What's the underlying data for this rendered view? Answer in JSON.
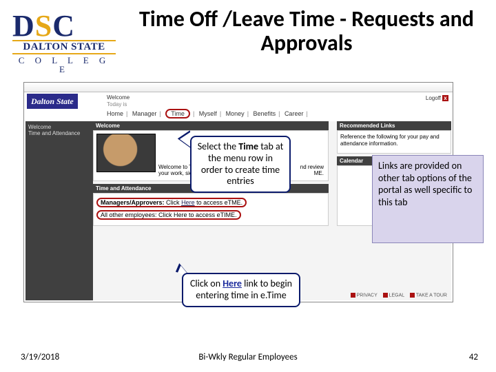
{
  "title": "Time Off /Leave Time - Requests and Approvals",
  "logo": {
    "initials_d": "D",
    "initials_s": "S",
    "initials_c": "C",
    "line1": "DALTON STATE",
    "line2": "C O L L E G E"
  },
  "callouts": {
    "time_tab_pre": "Select the ",
    "time_tab_bold": "Time",
    "time_tab_post": " tab at the menu row in order to create time entries",
    "here_pre": "Click on ",
    "here_link": "Here",
    "here_post": " link to begin entering time in e.Time"
  },
  "note": "Links are provided on other tab options of the portal as well specific to this tab",
  "screenshot": {
    "brand": "Dalton State",
    "logout": "Logoff",
    "welcome_user": "Welcome",
    "today": "Today is",
    "menu": [
      "Home",
      "Manager",
      "Time",
      "Myself",
      "Money",
      "Benefits",
      "Career"
    ],
    "sidebar": {
      "line1": "Welcome",
      "line2": "Time and Attendance"
    },
    "panel_welcome_h": "Welcome",
    "panel_welcome_text1": "Welcome to Time and Att",
    "panel_welcome_text2": "your work, sick, vacation",
    "panel_welcome_text_tail": "nd review\nME.",
    "ta_h": "Time and Attendance",
    "ta_row1_a": "Managers/Approvers:",
    "ta_row1_b": "Click",
    "ta_row1_here": "Here",
    "ta_row1_c": "to access eTME.",
    "ta_row2": "All other employees: Click Here to access eTIME.",
    "rec_h": "Recommended Links",
    "rec_b": "Reference the following for your pay and attendance information.",
    "cal_h": "Calendar",
    "footer_links": [
      "PRIVACY",
      "LEGAL",
      "TAKE A TOUR"
    ]
  },
  "footer": {
    "date": "3/19/2018",
    "mid": "Bi-Wkly Regular Employees",
    "num": "42"
  }
}
